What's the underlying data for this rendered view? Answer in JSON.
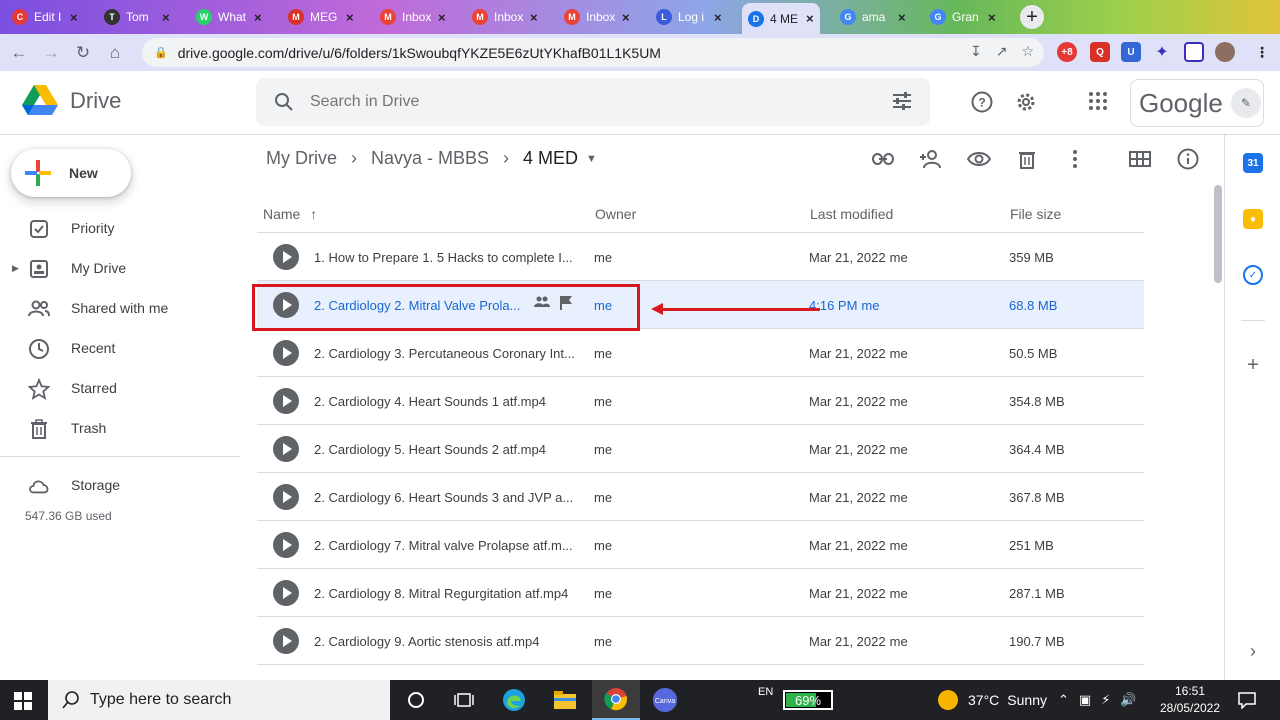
{
  "browser": {
    "tabs": [
      {
        "label": "Edit I",
        "fav_color": "#e53935",
        "fav": "C"
      },
      {
        "label": "Tom",
        "fav_color": "#333333",
        "fav": "T"
      },
      {
        "label": "What",
        "fav_color": "#25d366",
        "fav": "W"
      },
      {
        "label": "MEG",
        "fav_color": "#d93025",
        "fav": "M"
      },
      {
        "label": "Inbox",
        "fav_color": "#ea4335",
        "fav": "M"
      },
      {
        "label": "Inbox",
        "fav_color": "#ea4335",
        "fav": "M"
      },
      {
        "label": "Inbox",
        "fav_color": "#ea4335",
        "fav": "M"
      },
      {
        "label": "Log i",
        "fav_color": "#3b5bdb",
        "fav": "L"
      },
      {
        "label": "4 ME",
        "fav_color": "#1a73e8",
        "fav": "D",
        "active": true
      },
      {
        "label": "ama",
        "fav_color": "#4285f4",
        "fav": "G"
      },
      {
        "label": "Gran",
        "fav_color": "#4285f4",
        "fav": "G"
      }
    ],
    "url": "drive.google.com/drive/u/6/folders/1kSwoubqfYKZE5E6zUtYKhafB01L1K5UM"
  },
  "drive": {
    "product": "Drive",
    "search_placeholder": "Search in Drive",
    "google_word": "Google",
    "new_label": "New",
    "sidebar": [
      {
        "label": "Priority",
        "icon": "priority-icon"
      },
      {
        "label": "My Drive",
        "icon": "my-drive-icon"
      },
      {
        "label": "Shared with me",
        "icon": "shared-icon"
      },
      {
        "label": "Recent",
        "icon": "recent-icon"
      },
      {
        "label": "Starred",
        "icon": "star-icon"
      },
      {
        "label": "Trash",
        "icon": "trash-icon"
      }
    ],
    "storage_label": "Storage",
    "storage_used": "547.36 GB used",
    "breadcrumb": [
      "My Drive",
      "Navya - MBBS",
      "4 MED"
    ],
    "columns": {
      "name": "Name",
      "owner": "Owner",
      "modified": "Last modified",
      "size": "File size"
    },
    "files": [
      {
        "name": "1. How to Prepare 1. 5 Hacks to complete I...",
        "owner": "me",
        "modified": "Mar 21, 2022",
        "by": "me",
        "size": "359 MB"
      },
      {
        "name": "2. Cardiology 2. Mitral Valve Prola...",
        "owner": "me",
        "modified": "4:16 PM",
        "by": "me",
        "size": "68.8 MB",
        "selected": true
      },
      {
        "name": "2. Cardiology 3. Percutaneous Coronary Int...",
        "owner": "me",
        "modified": "Mar 21, 2022",
        "by": "me",
        "size": "50.5 MB"
      },
      {
        "name": "2. Cardiology 4. Heart Sounds 1 atf.mp4",
        "owner": "me",
        "modified": "Mar 21, 2022",
        "by": "me",
        "size": "354.8 MB"
      },
      {
        "name": "2. Cardiology 5. Heart Sounds 2 atf.mp4",
        "owner": "me",
        "modified": "Mar 21, 2022",
        "by": "me",
        "size": "364.4 MB"
      },
      {
        "name": "2. Cardiology 6. Heart Sounds 3 and JVP a...",
        "owner": "me",
        "modified": "Mar 21, 2022",
        "by": "me",
        "size": "367.8 MB"
      },
      {
        "name": "2. Cardiology 7. Mitral valve Prolapse atf.m...",
        "owner": "me",
        "modified": "Mar 21, 2022",
        "by": "me",
        "size": "251 MB"
      },
      {
        "name": "2. Cardiology 8. Mitral Regurgitation atf.mp4",
        "owner": "me",
        "modified": "Mar 21, 2022",
        "by": "me",
        "size": "287.1 MB"
      },
      {
        "name": "2. Cardiology 9. Aortic stenosis atf.mp4",
        "owner": "me",
        "modified": "Mar 21, 2022",
        "by": "me",
        "size": "190.7 MB"
      }
    ]
  },
  "taskbar": {
    "search_placeholder": "Type here to search",
    "lang": "EN",
    "battery": "69%",
    "battery_level": 0.69,
    "weather_temp": "37°C",
    "weather_desc": "Sunny",
    "time": "16:51",
    "date": "28/05/2022"
  },
  "colors": {
    "accent": "#1a73e8",
    "selected_row": "#e8f0fe",
    "annotation": "#d7191f"
  }
}
